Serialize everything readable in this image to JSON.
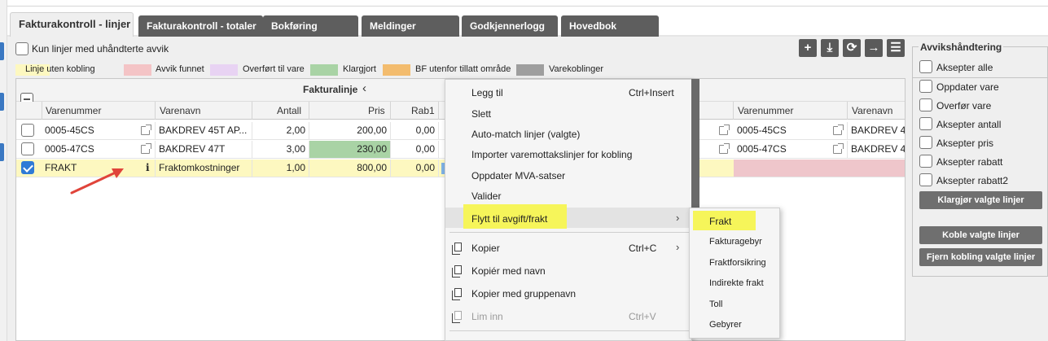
{
  "tabs": [
    {
      "label": "Fakturakontroll - linjer",
      "active": true
    },
    {
      "label": "Fakturakontroll - totaler",
      "active": false
    },
    {
      "label": "Bokføring",
      "active": false
    },
    {
      "label": "Meldinger",
      "active": false
    },
    {
      "label": "Godkjennerlogg",
      "active": false
    },
    {
      "label": "Hovedbok",
      "active": false
    }
  ],
  "filter": {
    "label": "Kun linjer med uhåndterte avvik",
    "checked": false
  },
  "legend": [
    {
      "label": "Linje uten kobling",
      "color": "#fdf8c0"
    },
    {
      "label": "Avvik funnet",
      "color": "#f4c4c6"
    },
    {
      "label": "Overført til vare",
      "color": "#e8d3f3"
    },
    {
      "label": "Klargjort",
      "color": "#a9d3a5"
    },
    {
      "label": "BF utenfor tillatt område",
      "color": "#f3bc6e"
    },
    {
      "label": "Varekoblinger",
      "color": "#9e9e9e"
    }
  ],
  "toolbar": {
    "add_icon": "plus-icon",
    "download_icon": "download-icon",
    "refresh_icon": "refresh-icon",
    "arrow_icon": "arrow-right-icon",
    "menu_icon": "menu-icon",
    "add_glyph": "+",
    "download_glyph": "⤓",
    "refresh_glyph": "⟳",
    "arrow_glyph": "→",
    "menu_glyph": "☰"
  },
  "grid": {
    "group_header": "Fakturalinje",
    "group_chevron": "‹",
    "columns": [
      "Varenummer",
      "Varenavn",
      "Antall",
      "Pris",
      "Rab1"
    ],
    "right_columns": [
      "Varenummer",
      "Varenavn"
    ],
    "rows": [
      {
        "checked": false,
        "varenummer": "0005-45CS",
        "varenavn": "BAKDREV 45T AP...",
        "antall": "2,00",
        "pris": "200,00",
        "rab1": "0,00",
        "r_varenummer": "0005-45CS",
        "r_varenavn": "BAKDREV 4"
      },
      {
        "checked": false,
        "varenummer": "0005-47CS",
        "varenavn": "BAKDREV 47T",
        "antall": "3,00",
        "pris": "230,00",
        "rab1": "0,00",
        "r_varenummer": "0005-47CS",
        "r_varenavn": "BAKDREV 4"
      },
      {
        "checked": true,
        "varenummer": "FRAKT",
        "info": "i",
        "varenavn": "Fraktomkostninger",
        "antall": "1,00",
        "pris": "800,00",
        "rab1": "0,00",
        "r_varenummer": "",
        "r_varenavn": ""
      }
    ]
  },
  "context_menu": {
    "items": [
      {
        "label": "Legg til",
        "shortcut": "Ctrl+Insert"
      },
      {
        "label": "Slett",
        "shortcut": ""
      },
      {
        "label": "Auto-match linjer (valgte)",
        "shortcut": ""
      },
      {
        "label": "Importer varemottakslinjer for kobling",
        "shortcut": ""
      },
      {
        "label": "Oppdater MVA-satser",
        "shortcut": ""
      },
      {
        "label": "Valider",
        "shortcut": ""
      },
      {
        "label": "Flytt til avgift/frakt",
        "shortcut": "",
        "submenu": true
      },
      {
        "label": "Kopier",
        "shortcut": "Ctrl+C",
        "submenu": true
      },
      {
        "label": "Kopiér med navn",
        "shortcut": ""
      },
      {
        "label": "Kopier med gruppenavn",
        "shortcut": ""
      },
      {
        "label": "Lim inn",
        "shortcut": "Ctrl+V",
        "disabled": true
      }
    ],
    "submenu_arrow": "›"
  },
  "submenu": {
    "items": [
      "Frakt",
      "Fakturagebyr",
      "Fraktforsikring",
      "Indirekte frakt",
      "Toll",
      "Gebyrer"
    ]
  },
  "deviation_panel": {
    "title": "Avvikshåndtering",
    "accept_all": "Aksepter alle",
    "options": [
      "Oppdater vare",
      "Overfør vare",
      "Aksepter antall",
      "Aksepter pris",
      "Aksepter rabatt",
      "Aksepter rabatt2"
    ],
    "prepare_button": "Klargjør valgte linjer",
    "link_button": "Koble valgte linjer",
    "unlink_button": "Fjern kobling valgte linjer"
  },
  "colors": {
    "highlight": "#f6f55a",
    "annotation_arrow": "#e0443a"
  }
}
